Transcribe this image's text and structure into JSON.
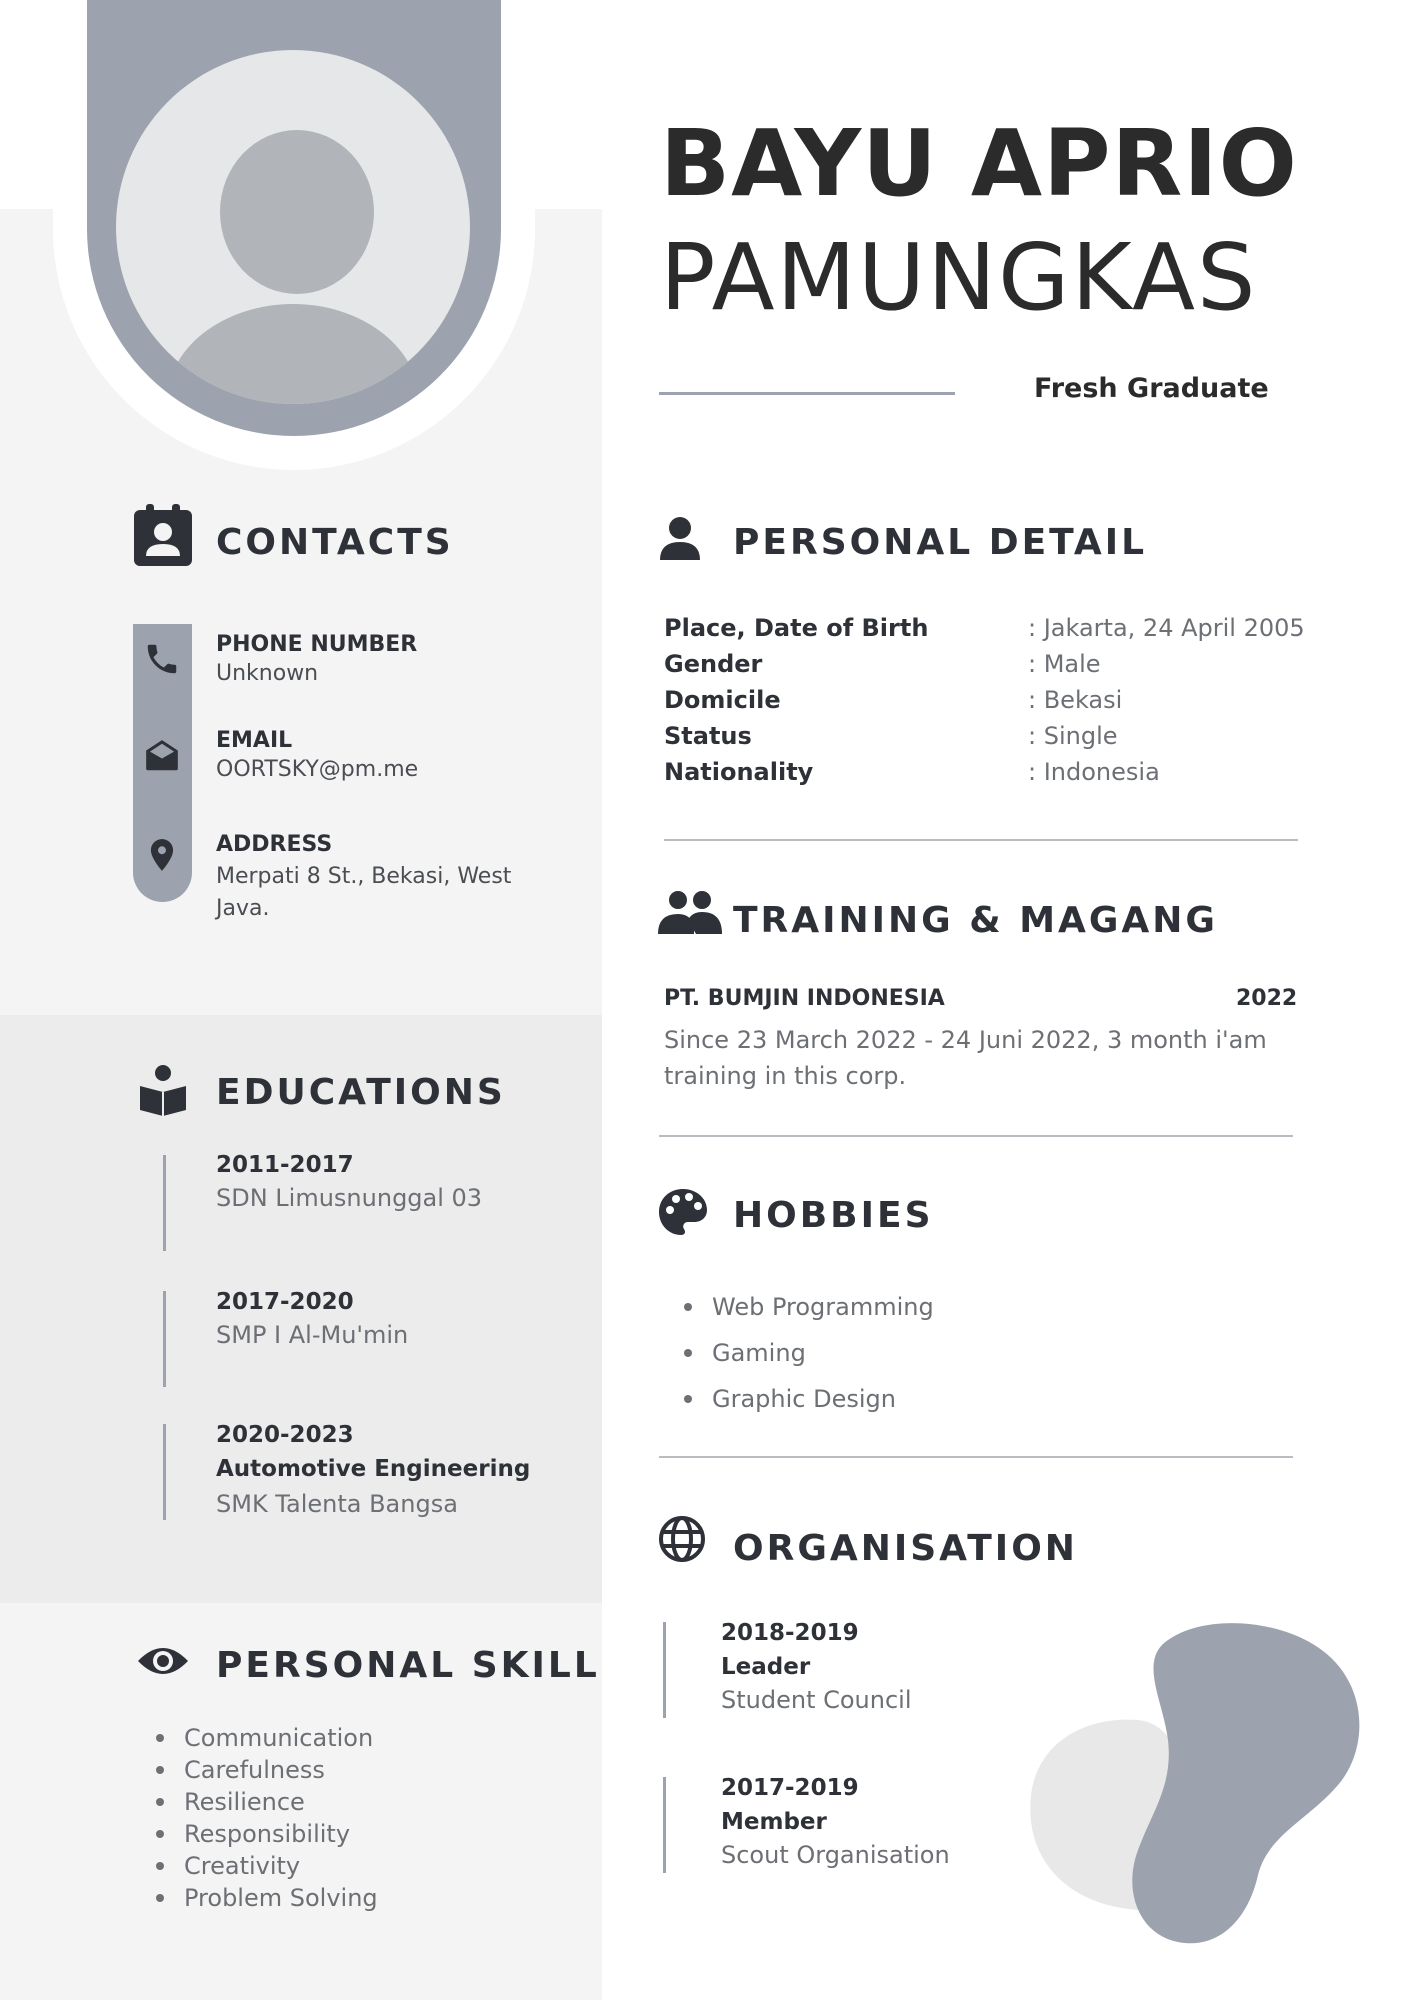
{
  "header": {
    "first_name": "BAYU APRIO",
    "last_name": "PAMUNGKAS",
    "subtitle": "Fresh Graduate"
  },
  "contacts": {
    "title": "CONTACTS",
    "items": [
      {
        "label": "PHONE NUMBER",
        "value": "Unknown",
        "icon": "phone-icon"
      },
      {
        "label": "EMAIL",
        "value": "OORTSKY@pm.me",
        "icon": "mail-icon"
      },
      {
        "label": "ADDRESS",
        "value": "Merpati 8 St., Bekasi, West Java.",
        "icon": "location-pin-icon"
      }
    ]
  },
  "educations": {
    "title": "EDUCATIONS",
    "items": [
      {
        "years": "2011-2017",
        "major": "",
        "school": "SDN Limusnunggal 03"
      },
      {
        "years": "2017-2020",
        "major": "",
        "school": "SMP I Al-Mu'min"
      },
      {
        "years": "2020-2023",
        "major": "Automotive Engineering",
        "school": "SMK Talenta Bangsa"
      }
    ]
  },
  "skills": {
    "title": "PERSONAL SKILL",
    "items": [
      "Communication",
      "Carefulness",
      "Resilience",
      "Responsibility",
      "Creativity",
      "Problem Solving"
    ]
  },
  "personal_detail": {
    "title": "PERSONAL DETAIL",
    "rows": [
      {
        "key": "Place, Date of Birth",
        "value": ": Jakarta, 24 April 2005"
      },
      {
        "key": "Gender",
        "value": ": Male"
      },
      {
        "key": "Domicile",
        "value": ": Bekasi"
      },
      {
        "key": "Status",
        "value": ": Single"
      },
      {
        "key": "Nationality",
        "value": ": Indonesia"
      }
    ]
  },
  "training": {
    "title": "TRAINING & MAGANG",
    "company": "PT. BUMJIN INDONESIA",
    "year": "2022",
    "description": "Since 23 March 2022 - 24 Juni 2022, 3 month i'am training in this corp."
  },
  "hobbies": {
    "title": "HOBBIES",
    "items": [
      "Web Programming",
      "Gaming",
      "Graphic Design"
    ]
  },
  "organisation": {
    "title": "ORGANISATION",
    "items": [
      {
        "years": "2018-2019",
        "role": "Leader",
        "org": "Student Council"
      },
      {
        "years": "2017-2019",
        "role": "Member",
        "org": "Scout Organisation"
      }
    ]
  },
  "colors": {
    "accent": "#9da3ae",
    "panel_light": "#f4f4f4",
    "panel_mid": "#ececec",
    "text_dark": "#2e3137",
    "text_grey": "#6c6f74"
  }
}
